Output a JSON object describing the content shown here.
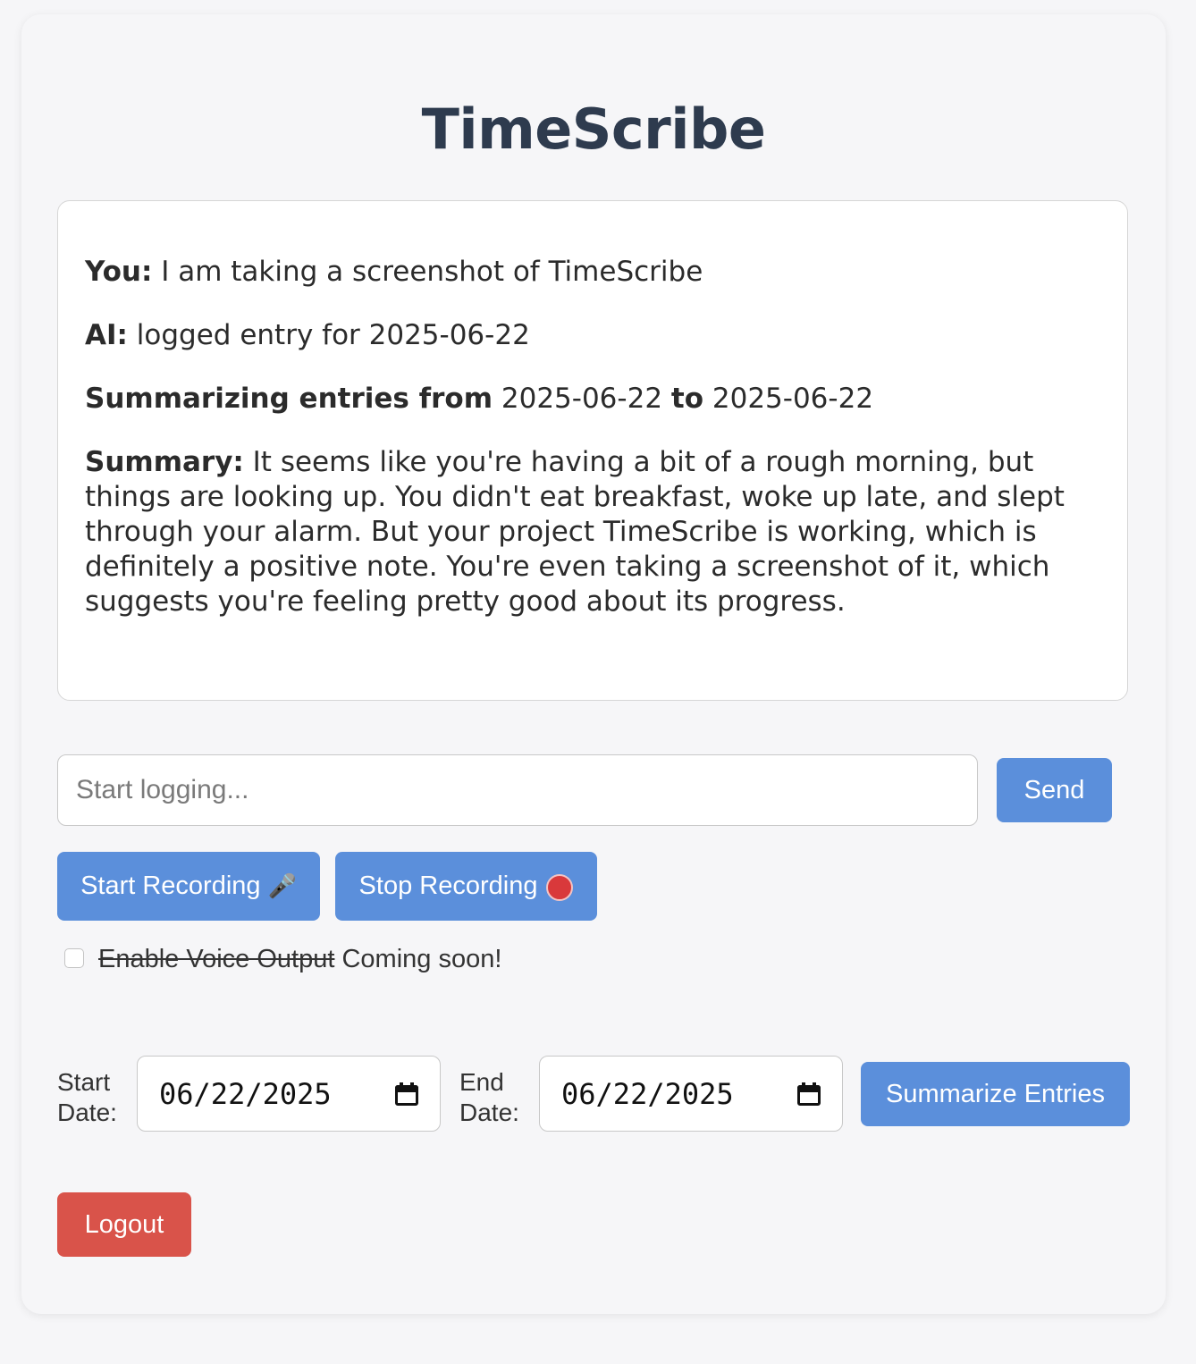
{
  "app": {
    "title": "TimeScribe"
  },
  "chat": {
    "messages": [
      {
        "speaker": "You:",
        "text": " I am taking a screenshot of TimeScribe"
      },
      {
        "speaker": "AI:",
        "text": " logged entry for 2025-06-22"
      }
    ],
    "range": {
      "prefix": "Summarizing entries from",
      "start": " 2025-06-22 ",
      "connector": "to",
      "end": " 2025-06-22"
    },
    "summary": {
      "label": "Summary:",
      "text": " It seems like you're having a bit of a rough morning, but things are looking up. You didn't eat breakfast, woke up late, and slept through your alarm. But your project TimeScribe is working, which is definitely a positive note. You're even taking a screenshot of it, which suggests you're feeling pretty good about its progress."
    }
  },
  "composer": {
    "placeholder": "Start logging...",
    "value": "",
    "send_label": "Send"
  },
  "recording": {
    "start_label": "Start Recording",
    "start_icon": "🎤",
    "stop_label": "Stop Recording",
    "stop_icon": "stop-sign"
  },
  "voice_output": {
    "checked": false,
    "label": "Enable Voice Output",
    "note": " Coming soon!"
  },
  "summary_controls": {
    "start_label": "Start Date:",
    "start_value": "06/22/2025",
    "end_label": "End Date:",
    "end_value": "06/22/2025",
    "button_label": "Summarize Entries"
  },
  "account": {
    "logout_label": "Logout"
  },
  "colors": {
    "primary_button": "#5b8fdb",
    "danger_button": "#d9534a",
    "title": "#2e3b4e",
    "background": "#f6f6f8"
  }
}
